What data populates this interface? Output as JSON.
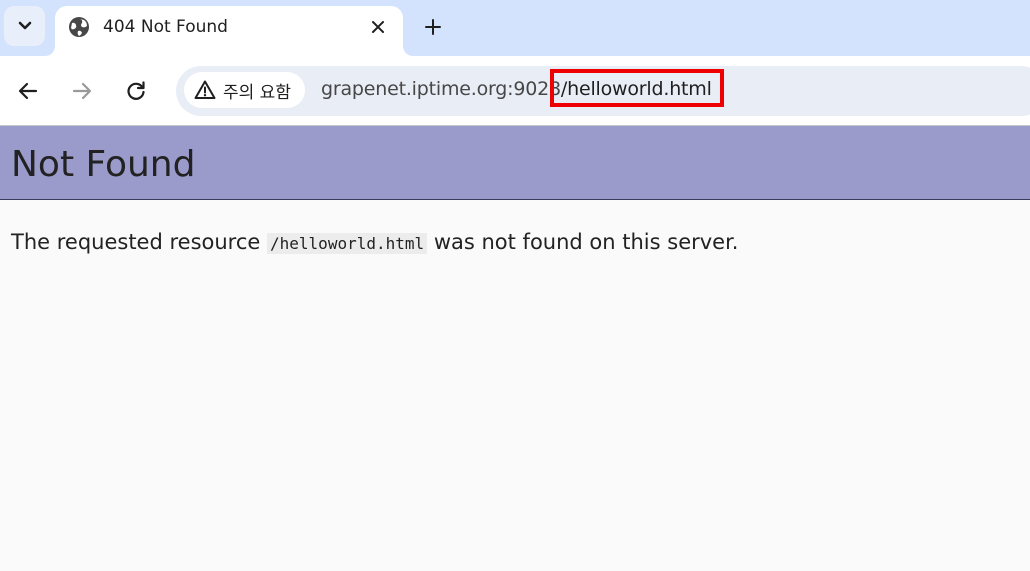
{
  "tab_strip": {
    "tab": {
      "title": "404 Not Found",
      "favicon": "globe-icon"
    },
    "tab_search_icon": "chevron-down-icon",
    "close_icon": "close-icon",
    "new_tab_icon": "plus-icon"
  },
  "toolbar": {
    "back_icon": "arrow-left-icon",
    "forward_icon": "arrow-right-icon",
    "reload_icon": "reload-icon",
    "security_chip": {
      "icon": "warning-icon",
      "label": "주의 요함"
    },
    "url": {
      "host": "grapenet.iptime.org:9028",
      "path": "/helloworld.html"
    }
  },
  "annotation": {
    "highlight_color": "#ee0000"
  },
  "page": {
    "title": "Not Found",
    "message_prefix": "The requested resource",
    "resource_path": "/helloworld.html",
    "message_suffix": "was not found on this server.",
    "header_color": "#9a9acb"
  }
}
